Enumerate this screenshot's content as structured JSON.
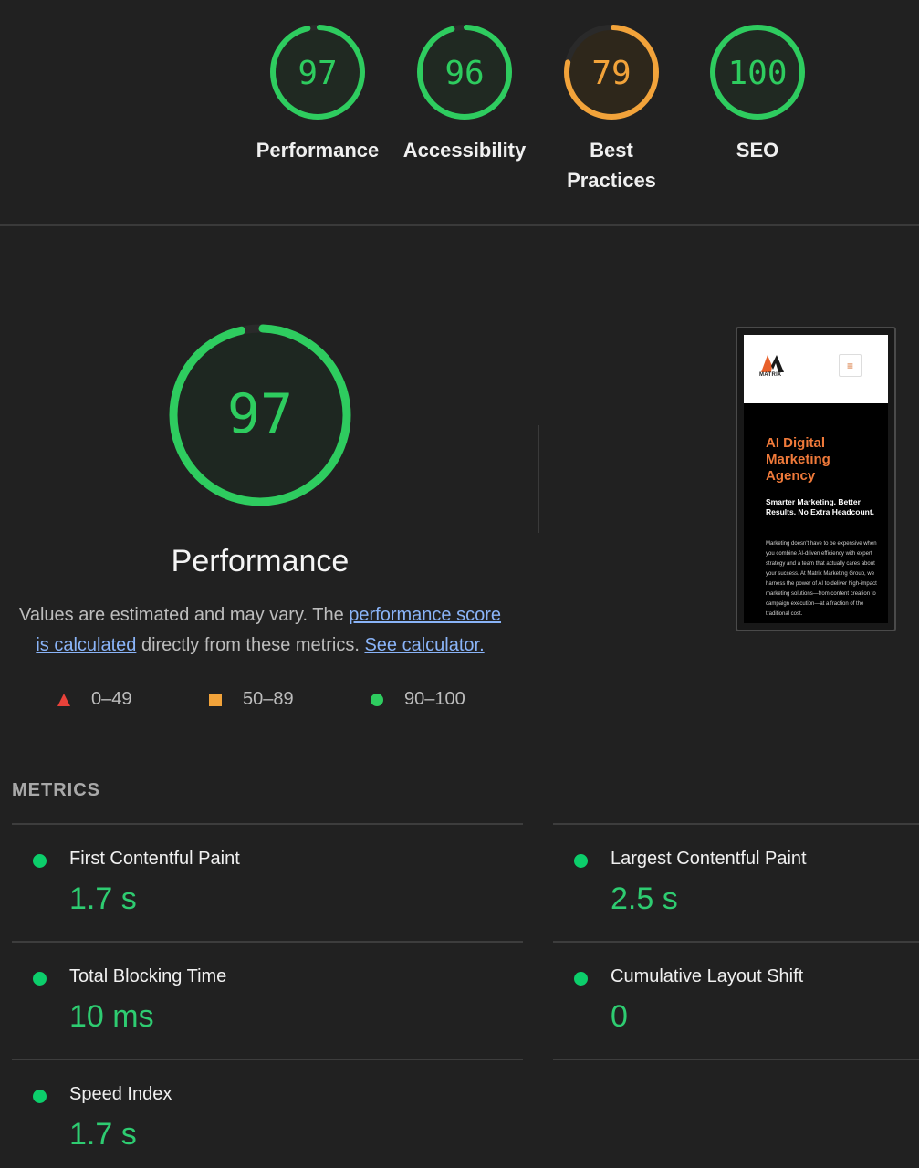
{
  "categories": [
    {
      "label": "Performance",
      "score": "97",
      "fraction": 0.97,
      "color": "#2ecc5f"
    },
    {
      "label": "Accessibility",
      "score": "96",
      "fraction": 0.96,
      "color": "#2ecc5f"
    },
    {
      "label": "Best Practices",
      "score": "79",
      "fraction": 0.79,
      "color": "#f2a33a"
    },
    {
      "label": "SEO",
      "score": "100",
      "fraction": 1.0,
      "color": "#2ecc5f"
    }
  ],
  "main": {
    "score": "97",
    "fraction": 0.97,
    "title": "Performance",
    "note_prefix": "Values are estimated and may vary. The ",
    "note_link1": "performance score is calculated",
    "note_middle": " directly from these metrics. ",
    "note_link2": "See calculator."
  },
  "legend": {
    "fail": "0–49",
    "average": "50–89",
    "pass": "90–100",
    "colors": {
      "fail": "#e8423a",
      "average": "#f2a33a",
      "pass": "#2ecc5f"
    }
  },
  "thumbnail": {
    "logo_text": "MATRIX",
    "menu_icon": "hamburger-icon",
    "headline": "AI Digital Marketing Agency",
    "subheadline": "Smarter Marketing. Better Results. No Extra Headcount.",
    "body": "Marketing doesn't have to be expensive when you combine AI-driven efficiency with expert strategy and a team that actually cares about your success. At Matrix Marketing Group, we harness the power of AI to deliver high-impact marketing solutions—from content creation to campaign execution—at a fraction of the traditional cost."
  },
  "metrics": {
    "heading": "METRICS",
    "items": [
      {
        "label": "First Contentful Paint",
        "value": "1.7 s"
      },
      {
        "label": "Largest Contentful Paint",
        "value": "2.5 s"
      },
      {
        "label": "Total Blocking Time",
        "value": "10 ms"
      },
      {
        "label": "Cumulative Layout Shift",
        "value": "0"
      },
      {
        "label": "Speed Index",
        "value": "1.7 s"
      }
    ]
  }
}
